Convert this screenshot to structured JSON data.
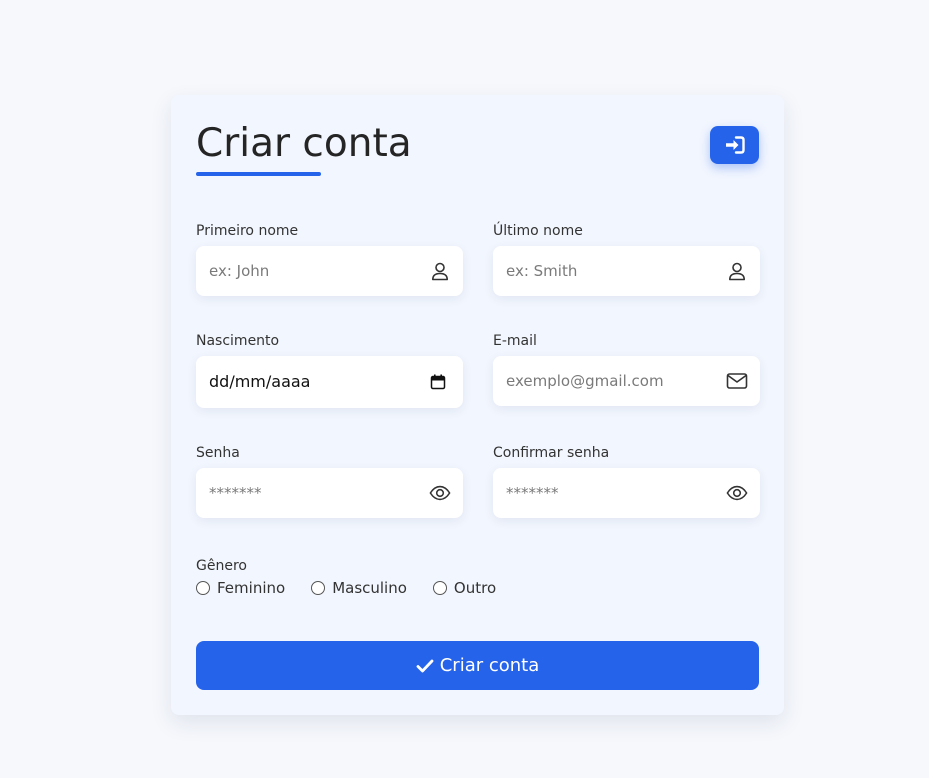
{
  "form": {
    "title": "Criar conta",
    "login_icon": "sign-in-icon",
    "fields": {
      "first_name": {
        "label": "Primeiro nome",
        "placeholder": "ex: John",
        "icon": "user-icon"
      },
      "last_name": {
        "label": "Último nome",
        "placeholder": "ex: Smith",
        "icon": "user-icon"
      },
      "birth": {
        "label": "Nascimento",
        "value": "dd/mm/aaaa",
        "icon": "calendar-icon"
      },
      "email": {
        "label": "E-mail",
        "placeholder": "exemplo@gmail.com",
        "icon": "mail-icon"
      },
      "password": {
        "label": "Senha",
        "placeholder": "*******",
        "icon": "eye-icon"
      },
      "confirm_password": {
        "label": "Confirmar senha",
        "placeholder": "*******",
        "icon": "eye-icon"
      }
    },
    "gender": {
      "label": "Gênero",
      "options": [
        "Feminino",
        "Masculino",
        "Outro"
      ]
    },
    "submit_label": "Criar conta",
    "submit_icon": "check-icon"
  },
  "colors": {
    "accent": "#2563eb",
    "background": "#f6f8fc",
    "card": "#f2f6fe"
  }
}
